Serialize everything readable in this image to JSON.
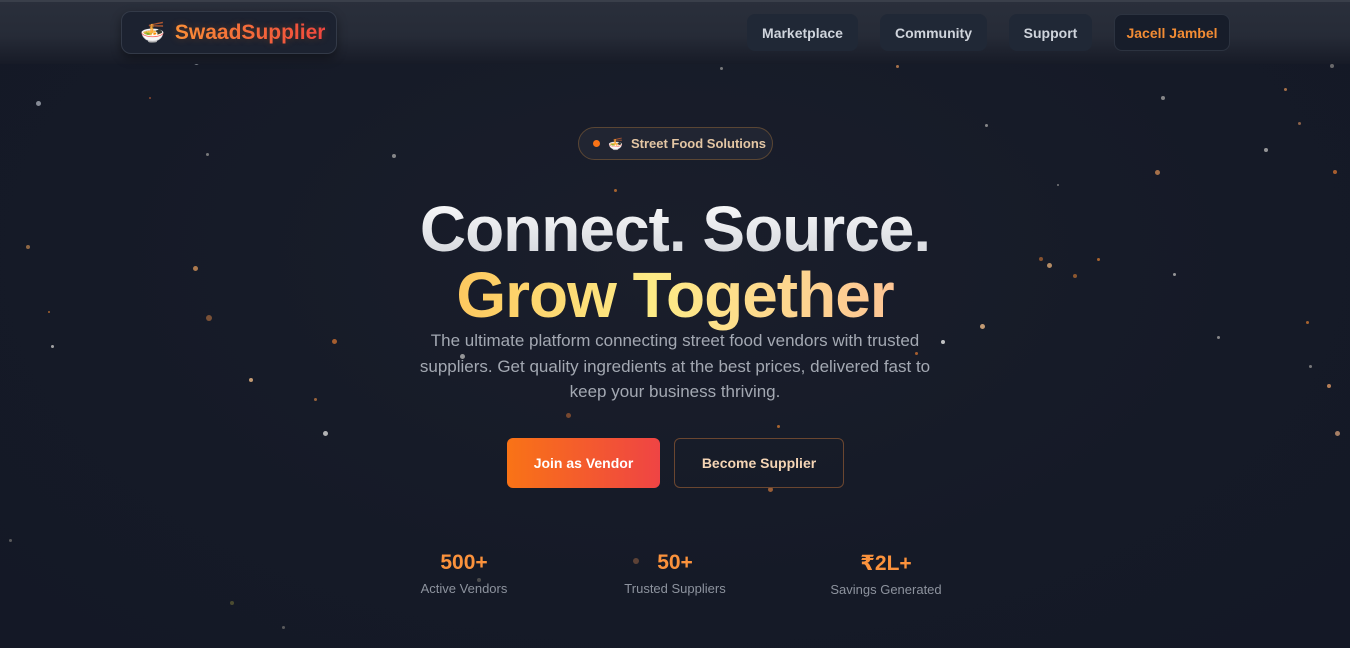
{
  "header": {
    "brand": "SwaadSupplier",
    "brand_icon": "noodle-bowl-icon",
    "nav": [
      {
        "label": "Marketplace"
      },
      {
        "label": "Community"
      },
      {
        "label": "Support"
      }
    ],
    "user": "Jacell Jambel"
  },
  "hero": {
    "badge": "Street Food Solutions",
    "badge_icon": "noodle-bowl-icon",
    "title_line1": "Connect. Source.",
    "title_line2": "Grow Together",
    "subtitle": "The ultimate platform connecting street food vendors with trusted suppliers. Get quality ingredients at the best prices, delivered fast to keep your business thriving.",
    "primary_cta": "Join as Vendor",
    "secondary_cta": "Become Supplier"
  },
  "stats": [
    {
      "value": "500+",
      "label": "Active Vendors"
    },
    {
      "value": "50+",
      "label": "Trusted Suppliers"
    },
    {
      "value": "₹2L+",
      "label": "Savings Generated"
    }
  ],
  "colors": {
    "accent": "#f97316",
    "accent2": "#ef4444",
    "background": "#151a27"
  }
}
